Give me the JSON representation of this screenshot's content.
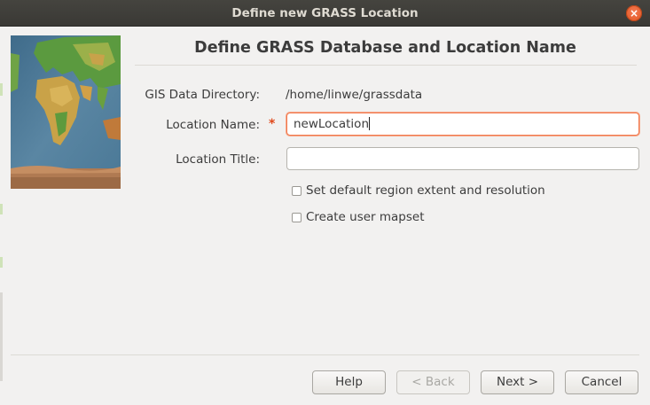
{
  "window": {
    "title": "Define new GRASS Location",
    "close_label": "×"
  },
  "page": {
    "heading": "Define GRASS Database and Location Name"
  },
  "form": {
    "gisdbase_label": "GIS Data Directory:",
    "gisdbase_value": "/home/linwe/grassdata",
    "location_label": "Location Name:",
    "required_marker": "*",
    "location_value": "newLocation",
    "title_label": "Location Title:",
    "title_value": ""
  },
  "options": [
    {
      "label": "Set default region extent and resolution",
      "checked": false
    },
    {
      "label": "Create user mapset",
      "checked": false
    }
  ],
  "buttons": {
    "help": "Help",
    "back": "< Back",
    "next": "Next >",
    "cancel": "Cancel"
  },
  "colors": {
    "accent": "#e1531d",
    "focus_border": "#f1784d",
    "titlebar": "#3a3935"
  }
}
